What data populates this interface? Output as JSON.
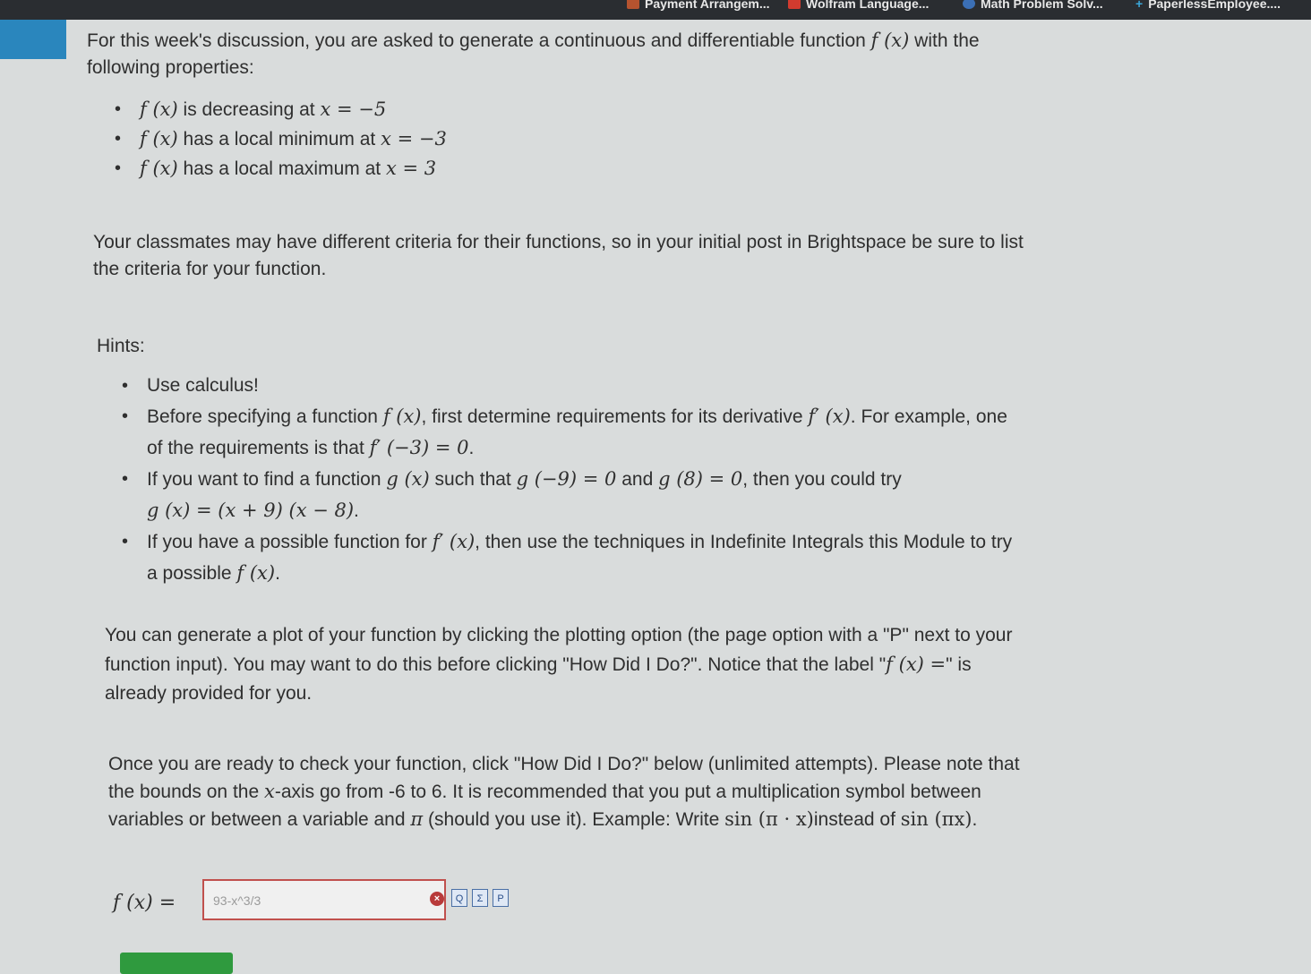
{
  "bookmarks": [
    "Payment Arrangem...",
    "Wolfram Language...",
    "Math Problem Solv...",
    "PaperlessEmployee...."
  ],
  "intro": {
    "line1_pre": "For this week's discussion, you are asked to generate a continuous and differentiable function ",
    "line1_fx": "f (x)",
    "line1_post": " with the",
    "line2": "following properties:"
  },
  "properties": [
    {
      "fx": "f (x)",
      "text": " is decreasing at ",
      "math": "x = −5"
    },
    {
      "fx": "f (x)",
      "text": " has a local minimum at ",
      "math": "x = −3"
    },
    {
      "fx": "f (x)",
      "text": " has a local maximum at ",
      "math": "x = 3"
    }
  ],
  "classmates": {
    "line1": "Your classmates may have different criteria for their functions, so in your initial post in Brightspace be sure to list",
    "line2": "the criteria for your function."
  },
  "hints_label": "Hints:",
  "hints": {
    "h1": "Use calculus!",
    "h2_pre": "Before specifying a function ",
    "h2_fx": "f (x)",
    "h2_mid": ", first determine requirements for its derivative ",
    "h2_fpx": "f′ (x)",
    "h2_post": ". For example, one",
    "h2_line2_pre": "of the requirements is that ",
    "h2_line2_math": "f′ (−3) = 0",
    "h2_line2_post": ".",
    "h3_pre": "If you want to find a function ",
    "h3_gx": "g (x)",
    "h3_mid": " such that ",
    "h3_m1": "g (−9) = 0",
    "h3_and": " and ",
    "h3_m2": "g (8) = 0",
    "h3_post": ", then you could try",
    "h3_line2": "g (x) = (x + 9) (x − 8)",
    "h3_line2_post": ".",
    "h4_pre": "If you have a possible function for ",
    "h4_fpx": "f′ (x)",
    "h4_post": ", then use the techniques in Indefinite Integrals this Module to try",
    "h4_line2_pre": "a possible ",
    "h4_line2_fx": "f (x)",
    "h4_line2_post": "."
  },
  "plot_para": {
    "line1": "You can generate a plot of your function by clicking the plotting option (the page option with a \"P\" next to your",
    "line2_pre": "function input). You may want to do this before clicking \"How Did I Do?\". Notice that the label \"",
    "line2_math": "f (x) =",
    "line2_post": "\" is",
    "line3": "already provided for you."
  },
  "check_para": {
    "line1": "Once you are ready to check your function, click \"How Did I Do?\" below (unlimited attempts). Please note that",
    "line2_pre": "the bounds on the ",
    "line2_x": "x",
    "line2_post": "-axis go from -6 to 6. It is recommended that you put a multiplication symbol between",
    "line3_pre": "variables or between a variable and ",
    "line3_pi": "π",
    "line3_mid": " (should you use it). Example: Write ",
    "line3_m1": "sin (π · x)",
    "line3_mid2": "instead of ",
    "line3_m2": "sin (πx)",
    "line3_post": "."
  },
  "answer": {
    "label": "f (x) =",
    "value": "93-x^3/3",
    "buttons": [
      "Q",
      "Σ",
      "P"
    ]
  },
  "colors": {
    "accent": "#2a86bd",
    "error_border": "#c0504d",
    "submit": "#2f9a3e"
  }
}
